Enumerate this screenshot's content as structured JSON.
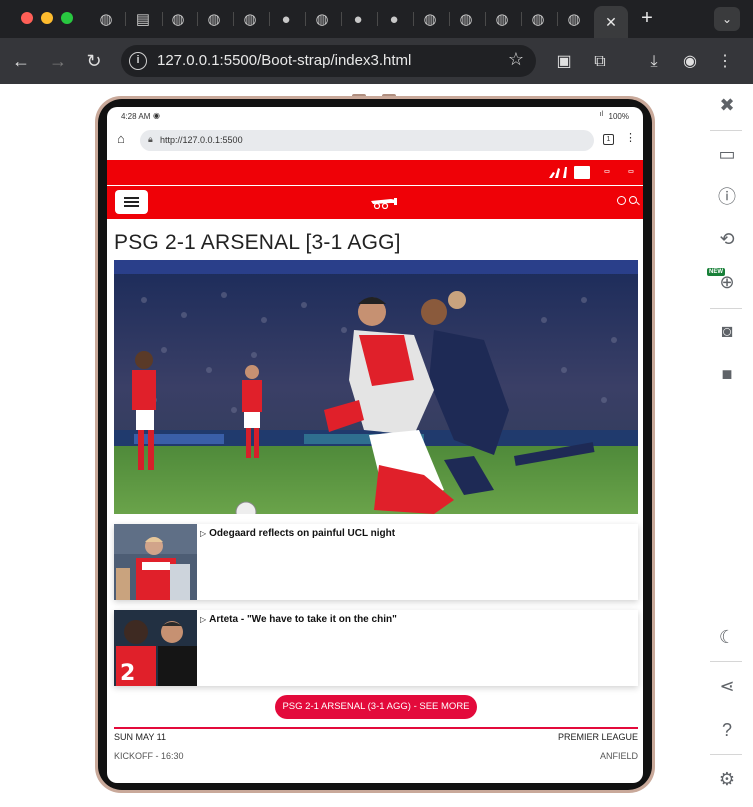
{
  "browser": {
    "url": "127.0.0.1:5500/Boot-strap/index3.html",
    "new_tab": "+",
    "active_tab_close": "✕",
    "tab_menu": "⌄"
  },
  "device": {
    "status_time": "4:28 AM",
    "status_right": "100%",
    "mobile_url": "http://127.0.0.1:5500",
    "tab_count": "1"
  },
  "site": {
    "headline": "PSG 2-1 ARSENAL [3-1 AGG]",
    "articles": [
      {
        "title": "Odegaard reflects on painful UCL night"
      },
      {
        "title": "Arteta - \"We have to take it on the chin\""
      }
    ],
    "see_more": "PSG 2-1 ARSENAL (3-1 AGG) - SEE MORE",
    "fixture": {
      "date": "SUN MAY 11",
      "competition": "PREMIER LEAGUE",
      "kickoff": "KICKOFF - 16:30",
      "venue": "ANFIELD"
    }
  },
  "side_panel": {
    "new_badge": "NEW"
  },
  "colors": {
    "arsenal_red": "#ef0107",
    "cta_red": "#e30a3b",
    "chrome_dark": "#202124",
    "chrome_toolbar": "#35363a"
  }
}
